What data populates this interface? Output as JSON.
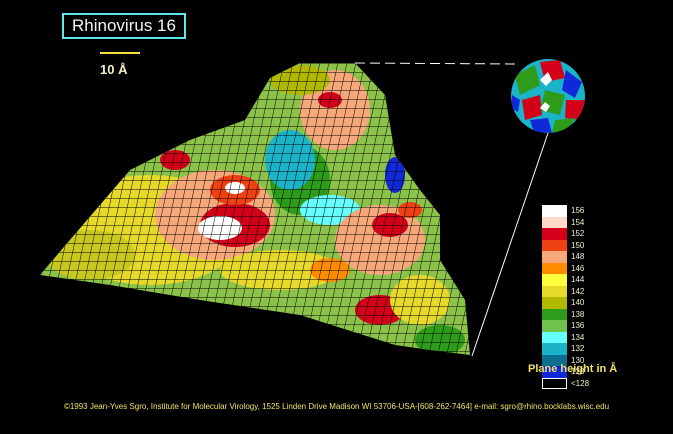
{
  "title": "Rhinovirus 16",
  "scale": {
    "label": "10 Å"
  },
  "legend": {
    "title": "Plane height in Å",
    "entries": [
      {
        "label": "156",
        "color": "#ffffff"
      },
      {
        "label": "154",
        "color": "#ffd8c8"
      },
      {
        "label": "152",
        "color": "#d4001a"
      },
      {
        "label": "150",
        "color": "#ee4010"
      },
      {
        "label": "148",
        "color": "#f7a87a"
      },
      {
        "label": "146",
        "color": "#ff8c00"
      },
      {
        "label": "144",
        "color": "#ffff40"
      },
      {
        "label": "142",
        "color": "#e6d92a"
      },
      {
        "label": "140",
        "color": "#b0b800"
      },
      {
        "label": "138",
        "color": "#2e9b1a"
      },
      {
        "label": "136",
        "color": "#6fc24b"
      },
      {
        "label": "134",
        "color": "#66ffff"
      },
      {
        "label": "132",
        "color": "#1ab3c8"
      },
      {
        "label": "130",
        "color": "#0e6e8e"
      },
      {
        "label": "128",
        "color": "#1028d8"
      },
      {
        "label": "<128",
        "color": "#000000"
      }
    ]
  },
  "footer": "©1993 Jean-Yves Sgro, Institute for Molecular Virology, 1525 Linden Drive Madison WI 53706-USA-[608-262-7464] e-mail: sgro@rhino.bocklabs.wisc.edu"
}
